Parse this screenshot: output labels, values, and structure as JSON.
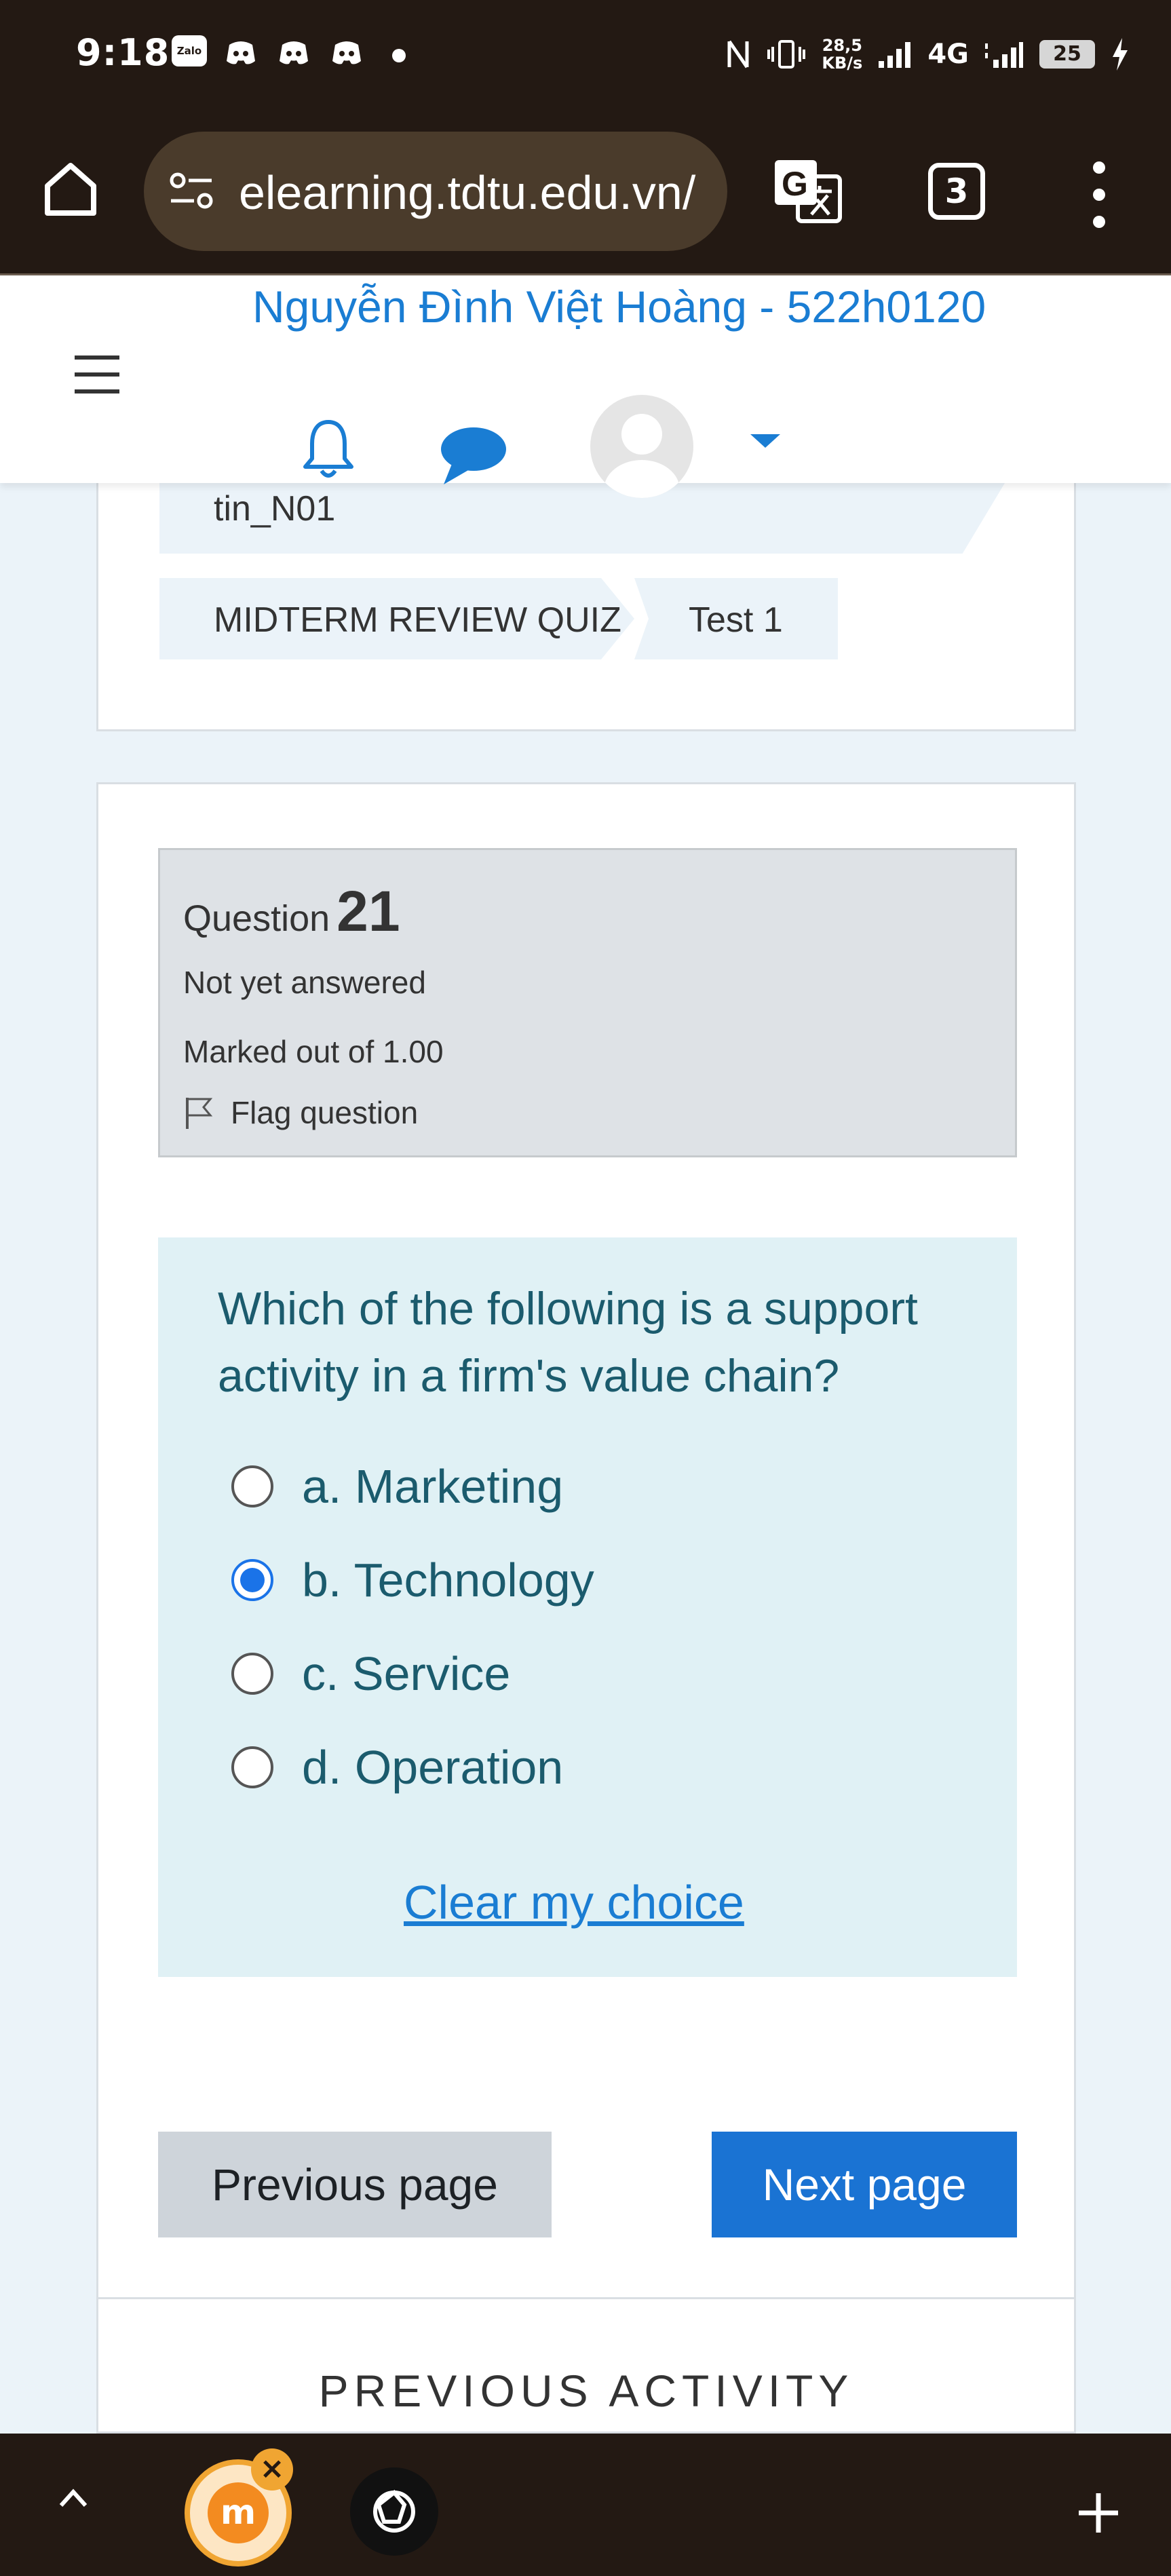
{
  "status_bar": {
    "time": "9:18",
    "zalo_label": "Zalo",
    "net_speed_value": "28,5",
    "net_speed_unit": "KB/s",
    "network": "4G",
    "battery": "25"
  },
  "browser": {
    "url": "elearning.tdtu.edu.vn/",
    "tab_count": "3"
  },
  "header": {
    "user_name": "Nguyễn Đình Việt Hoàng - 522h0120"
  },
  "breadcrumb": {
    "course": "tin_N01",
    "items": [
      "MIDTERM REVIEW QUIZ",
      "Test 1"
    ]
  },
  "question_info": {
    "label": "Question",
    "number": "21",
    "status": "Not yet answered",
    "marks": "Marked out of 1.00",
    "flag_label": "Flag question"
  },
  "question": {
    "text": "Which of the following is a support activity in a firm's value chain?",
    "options": [
      {
        "label": "a. Marketing",
        "selected": false
      },
      {
        "label": "b. Technology",
        "selected": true
      },
      {
        "label": "c. Service",
        "selected": false
      },
      {
        "label": "d. Operation",
        "selected": false
      }
    ],
    "clear_label": "Clear my choice"
  },
  "navigation": {
    "previous_label": "Previous page",
    "next_label": "Next page",
    "previous_activity_label": "PREVIOUS ACTIVITY"
  },
  "colors": {
    "accent": "#1a73d3",
    "link": "#1a7dd3",
    "question_text": "#1b5b6d",
    "question_bg": "#e0f1f5",
    "page_bg": "#ebf3f9",
    "system_bar": "#231913"
  },
  "icons": {
    "home": "home-icon",
    "tune": "site-settings-icon",
    "translate": "translate-icon",
    "bell": "bell-icon",
    "chat": "chat-icon",
    "flag": "flag-icon"
  }
}
